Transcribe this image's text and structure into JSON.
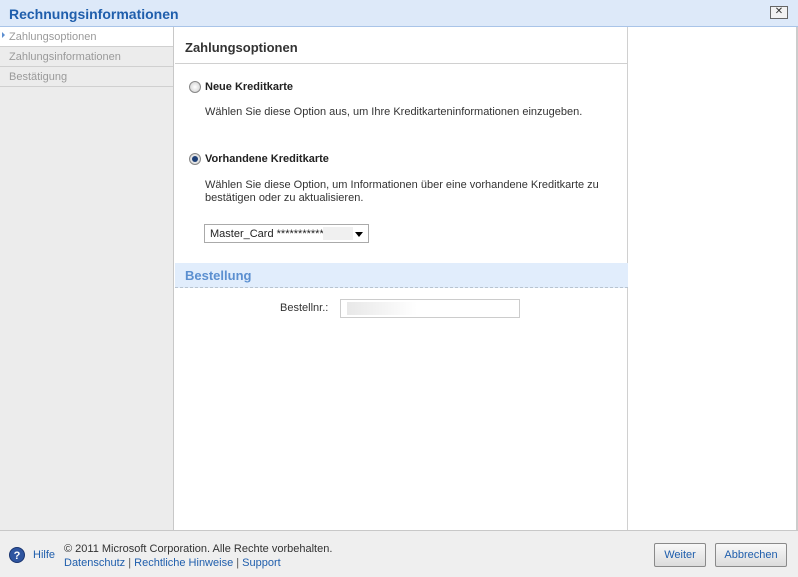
{
  "window": {
    "title": "Rechnungsinformationen",
    "close_label": "✕"
  },
  "sidebar": {
    "items": [
      {
        "label": "Zahlungsoptionen"
      },
      {
        "label": "Zahlungsinformationen"
      },
      {
        "label": "Bestätigung"
      }
    ]
  },
  "main": {
    "title": "Zahlungsoptionen",
    "options": [
      {
        "label": "Neue Kreditkarte",
        "description": "Wählen Sie diese Option aus, um Ihre Kreditkarteninformationen einzugeben.",
        "selected": false
      },
      {
        "label": "Vorhandene Kreditkarte",
        "description": "Wählen Sie diese Option, um Informationen über eine vorhandene Kreditkarte zu bestätigen oder zu aktualisieren.",
        "selected": true
      }
    ],
    "card_select": {
      "value": "Master_Card ************"
    },
    "order": {
      "section_title": "Bestellung",
      "label": "Bestellnr.:"
    }
  },
  "footer": {
    "help": "Hilfe",
    "copyright": "© 2011 Microsoft Corporation. Alle Rechte vorbehalten.",
    "links": [
      "Datenschutz",
      "Rechtliche Hinweise",
      "Support"
    ],
    "separator": "|",
    "next": "Weiter",
    "cancel": "Abbrechen"
  }
}
